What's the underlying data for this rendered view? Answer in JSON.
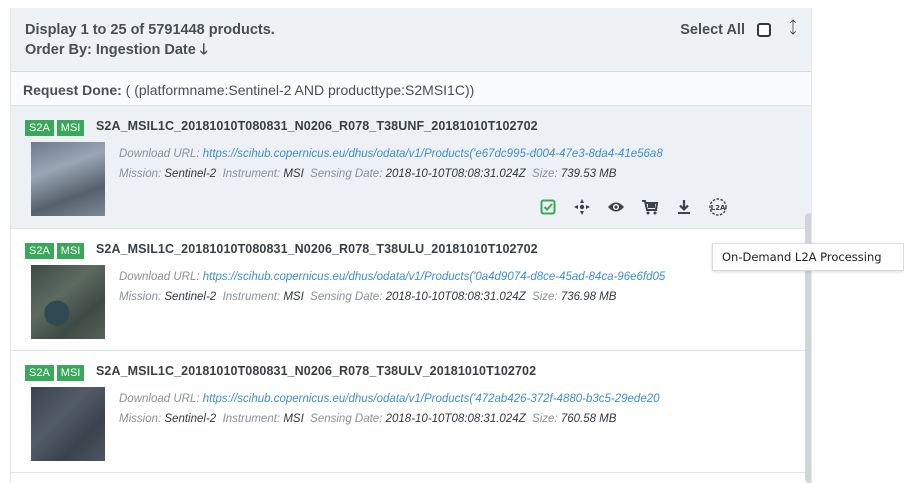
{
  "header": {
    "display_text": "Display 1 to 25 of 5791448 products.",
    "order_by": "Order By: Ingestion Date",
    "order_arrow": "🡓",
    "select_all": "Select All"
  },
  "request": {
    "label": "Request Done:",
    "query": " ( (platformname:Sentinel-2 AND producttype:S2MSI1C))"
  },
  "labels": {
    "download_url": "Download URL:",
    "mission": "Mission:",
    "instrument": "Instrument:",
    "sensing_date": "Sensing Date:",
    "size": "Size:"
  },
  "products": [
    {
      "tag1": "S2A",
      "tag2": "MSI",
      "name": "S2A_MSIL1C_20181010T080831_N0206_R078_T38UNF_20181010T102702",
      "url": "https://scihub.copernicus.eu/dhus/odata/v1/Products('e67dc995-d004-47e3-8da4-41e56a8",
      "mission": "Sentinel-2",
      "instrument": "MSI",
      "sensing_date": "2018-10-10T08:08:31.024Z",
      "size": "739.53 MB"
    },
    {
      "tag1": "S2A",
      "tag2": "MSI",
      "name": "S2A_MSIL1C_20181010T080831_N0206_R078_T38ULU_20181010T102702",
      "url": "https://scihub.copernicus.eu/dhus/odata/v1/Products('0a4d9074-d8ce-45ad-84ca-96e6fd05",
      "mission": "Sentinel-2",
      "instrument": "MSI",
      "sensing_date": "2018-10-10T08:08:31.024Z",
      "size": "736.98 MB"
    },
    {
      "tag1": "S2A",
      "tag2": "MSI",
      "name": "S2A_MSIL1C_20181010T080831_N0206_R078_T38ULV_20181010T102702",
      "url": "https://scihub.copernicus.eu/dhus/odata/v1/Products('472ab426-372f-4880-b3c5-29ede20",
      "mission": "Sentinel-2",
      "instrument": "MSI",
      "sensing_date": "2018-10-10T08:08:31.024Z",
      "size": "760.58 MB"
    }
  ],
  "actions": {
    "l2a_icon_text": "L2A",
    "icons": [
      "check-square-icon",
      "crosshair-icon",
      "eye-icon",
      "cart-icon",
      "download-icon",
      "l2a-process-icon"
    ]
  },
  "tooltip": {
    "text": "On-Demand L2A Processing"
  },
  "colors": {
    "tag_green": "#3aa85a",
    "link_blue": "#3f8ecf",
    "check_green": "#3aa85a"
  }
}
